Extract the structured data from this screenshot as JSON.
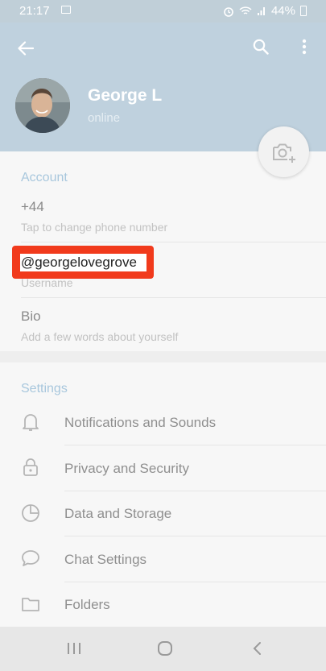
{
  "status_bar": {
    "time": "21:17",
    "battery": "44%"
  },
  "profile": {
    "name": "George L",
    "status": "online"
  },
  "account": {
    "section_title": "Account",
    "phone": {
      "value": "+44",
      "hint": "Tap to change phone number"
    },
    "username": {
      "value": "@georgelovegrove",
      "hint": "Username"
    },
    "bio": {
      "value": "Bio",
      "hint": "Add a few words about yourself"
    }
  },
  "settings": {
    "section_title": "Settings",
    "items": [
      {
        "label": "Notifications and Sounds",
        "icon": "bell-icon"
      },
      {
        "label": "Privacy and Security",
        "icon": "lock-icon"
      },
      {
        "label": "Data and Storage",
        "icon": "pie-chart-icon"
      },
      {
        "label": "Chat Settings",
        "icon": "chat-bubble-icon"
      },
      {
        "label": "Folders",
        "icon": "folder-icon"
      }
    ]
  },
  "colors": {
    "header": "#bfd1de",
    "accent_title": "#a8c7dd",
    "highlight": "#f13a1c"
  }
}
